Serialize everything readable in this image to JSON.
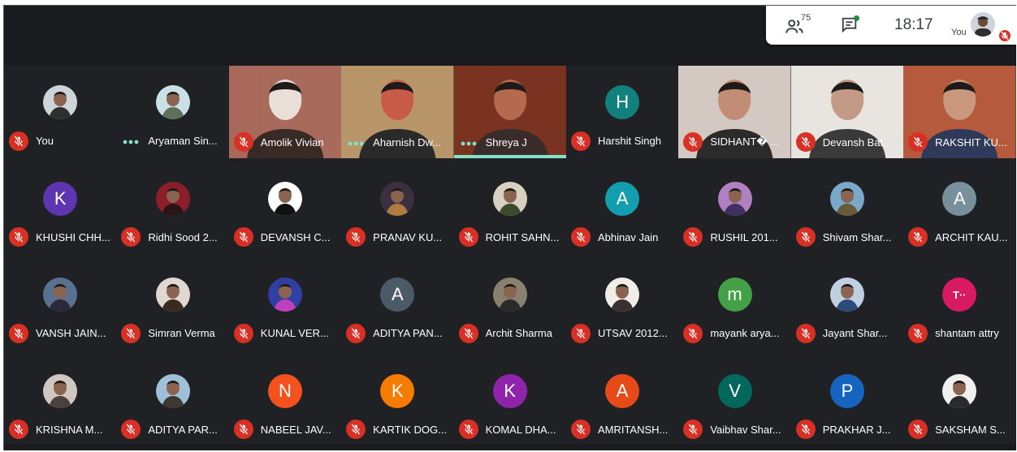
{
  "status_bar": {
    "people_count": "75",
    "time": "18:17",
    "self_label": "You"
  },
  "colors": {
    "background": "#202124",
    "muted": "#d93025",
    "speaking": "#81e2c9"
  },
  "participants": [
    {
      "name": "You",
      "type": "photo",
      "mic": "muted",
      "colors": [
        "#cdd5db",
        "#2f2f2f"
      ]
    },
    {
      "name": "Aryaman Sin...",
      "type": "photo",
      "mic": "active",
      "colors": [
        "#c9e1e6",
        "#5f6f5a"
      ]
    },
    {
      "name": "Amolik Vivian",
      "type": "video",
      "mic": "muted",
      "colors": [
        "#a86a5a",
        "#3a2a25",
        "#e9dfd8"
      ]
    },
    {
      "name": "Aharnish Dw...",
      "type": "video",
      "mic": "active",
      "colors": [
        "#b8966a",
        "#2a2a2a",
        "#c85a48"
      ]
    },
    {
      "name": "Shreya J",
      "type": "video",
      "mic": "active",
      "speaking": true,
      "colors": [
        "#7a3320",
        "#3a2c2a",
        "#b56a4f"
      ]
    },
    {
      "name": "Harshit Singh",
      "type": "letter",
      "mic": "muted",
      "letter": "H",
      "colors": [
        "#12807c"
      ]
    },
    {
      "name": "SIDHANT� ...",
      "type": "video",
      "mic": "muted",
      "colors": [
        "#d4c8c2",
        "#2b2b2b",
        "#c28d75"
      ]
    },
    {
      "name": "Devansh Bat...",
      "type": "video",
      "mic": "muted",
      "colors": [
        "#e8e4e0",
        "#3a3a3a",
        "#c29a85"
      ]
    },
    {
      "name": "RAKSHIT KU...",
      "type": "video",
      "mic": "muted",
      "colors": [
        "#b55a3c",
        "#2f3a5a",
        "#c9977d"
      ]
    },
    {
      "name": "KHUSHI CHH...",
      "type": "letter",
      "mic": "muted",
      "letter": "K",
      "colors": [
        "#5e35b1"
      ]
    },
    {
      "name": "Ridhi Sood 2...",
      "type": "photo",
      "mic": "muted",
      "colors": [
        "#8a1f2a",
        "#2a1618"
      ]
    },
    {
      "name": "DEVANSH C...",
      "type": "photo",
      "mic": "muted",
      "colors": [
        "#ffffff",
        "#111111"
      ]
    },
    {
      "name": "PRANAV KU...",
      "type": "photo",
      "mic": "muted",
      "colors": [
        "#3a3040",
        "#b07a40"
      ]
    },
    {
      "name": "ROHIT SAHN...",
      "type": "photo",
      "mic": "muted",
      "colors": [
        "#d8d0c0",
        "#3b4a2a"
      ]
    },
    {
      "name": "Abhinav Jain",
      "type": "letter",
      "mic": "muted",
      "letter": "A",
      "colors": [
        "#129eaf"
      ]
    },
    {
      "name": "RUSHIL 201...",
      "type": "photo",
      "mic": "muted",
      "colors": [
        "#b080c0",
        "#403060"
      ]
    },
    {
      "name": "Shivam Shar...",
      "type": "photo",
      "mic": "muted",
      "colors": [
        "#7aa8c8",
        "#6a5a3a"
      ]
    },
    {
      "name": "ARCHIT KAU...",
      "type": "letter",
      "mic": "muted",
      "letter": "A",
      "colors": [
        "#78909c"
      ]
    },
    {
      "name": "VANSH JAIN...",
      "type": "photo",
      "mic": "muted",
      "colors": [
        "#5a7090",
        "#2a2a3a"
      ]
    },
    {
      "name": "Simran Verma",
      "type": "photo",
      "mic": "muted",
      "colors": [
        "#e0d8d0",
        "#3a2a20"
      ]
    },
    {
      "name": "KUNAL VER...",
      "type": "photo",
      "mic": "muted",
      "colors": [
        "#3040a0",
        "#c040c0"
      ]
    },
    {
      "name": "ADITYA PAN...",
      "type": "letter",
      "mic": "muted",
      "letter": "A",
      "colors": [
        "#4a5a66"
      ]
    },
    {
      "name": "Archit Sharma",
      "type": "photo",
      "mic": "muted",
      "colors": [
        "#8a8070",
        "#2a2a2a"
      ]
    },
    {
      "name": "UTSAV 2012...",
      "type": "photo",
      "mic": "muted",
      "colors": [
        "#f0ece8",
        "#3a3030"
      ]
    },
    {
      "name": "mayank arya...",
      "type": "letter",
      "mic": "muted",
      "letter": "m",
      "colors": [
        "#43a047"
      ]
    },
    {
      "name": "Jayant Shar...",
      "type": "photo",
      "mic": "muted",
      "colors": [
        "#c0d0e0",
        "#2a4a7a"
      ]
    },
    {
      "name": "shantam attry",
      "type": "letter",
      "mic": "muted",
      "letter": "T··",
      "colors": [
        "#d81b60"
      ]
    },
    {
      "name": "KRISHNA M...",
      "type": "photo",
      "mic": "muted",
      "colors": [
        "#d0c8c0",
        "#4a4040"
      ]
    },
    {
      "name": "ADITYA PAR...",
      "type": "photo",
      "mic": "muted",
      "colors": [
        "#a0c0d8",
        "#3a3a30"
      ]
    },
    {
      "name": "NABEEL JAV...",
      "type": "letter",
      "mic": "muted",
      "letter": "N",
      "colors": [
        "#f4511e"
      ]
    },
    {
      "name": "KARTIK DOG...",
      "type": "letter",
      "mic": "muted",
      "letter": "K",
      "colors": [
        "#f57c00"
      ]
    },
    {
      "name": "KOMAL DHA...",
      "type": "letter",
      "mic": "muted",
      "letter": "K",
      "colors": [
        "#8e24aa"
      ]
    },
    {
      "name": "AMRITANSH...",
      "type": "letter",
      "mic": "muted",
      "letter": "A",
      "colors": [
        "#e64a19"
      ]
    },
    {
      "name": "Vaibhav Shar...",
      "type": "letter",
      "mic": "muted",
      "letter": "V",
      "colors": [
        "#00695c"
      ]
    },
    {
      "name": "PRAKHAR J...",
      "type": "letter",
      "mic": "muted",
      "letter": "P",
      "colors": [
        "#1565c0"
      ]
    },
    {
      "name": "SAKSHAM S...",
      "type": "photo",
      "mic": "muted",
      "colors": [
        "#f0f0f0",
        "#2a2a2a"
      ]
    }
  ]
}
